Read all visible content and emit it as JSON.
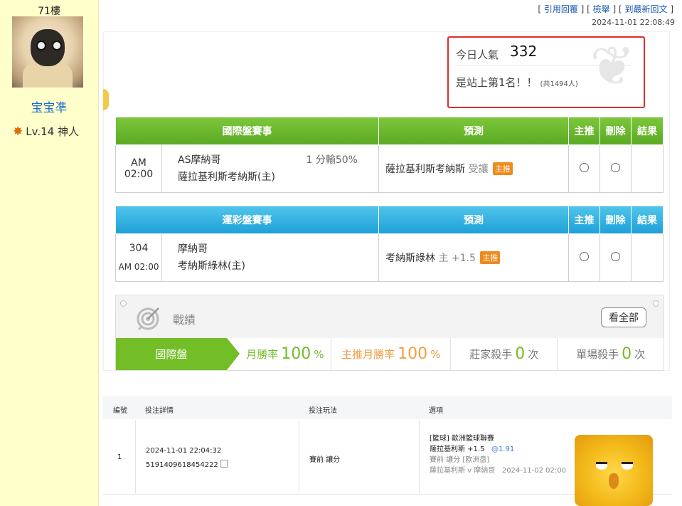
{
  "user": {
    "floor": "71樓",
    "name": "宝宝凖",
    "level": "Lv.14 神人"
  },
  "post": {
    "links": [
      "引用回覆",
      "檢舉",
      "到最新回文"
    ],
    "time": "2024-11-01 22:08:49"
  },
  "popularity": {
    "label": "今日人氣",
    "count": "332",
    "rank_text": "是站上第1名！！",
    "total": "(共1494人)"
  },
  "intl_table": {
    "headers": [
      "國際盤賽事",
      "預測",
      "主推",
      "刪除",
      "結果"
    ],
    "row": {
      "time": "AM 02:00",
      "team1": "AS摩納哥",
      "team2": "薩拉基利斯考納斯(主)",
      "odds": "1 分輸50%",
      "pick": "薩拉基利斯考納斯",
      "pick_type": "受讓",
      "tag": "主推"
    }
  },
  "lottery_table": {
    "headers": [
      "運彩盤賽事",
      "預測",
      "主推",
      "刪除",
      "結果"
    ],
    "row": {
      "number": "304",
      "time": "AM 02:00",
      "team1": "摩納哥",
      "team2": "考納斯綠林(主)",
      "pick": "考納斯綠林",
      "pick_type": "主 +1.5",
      "tag": "主推"
    }
  },
  "record": {
    "title": "戰績",
    "view_all": "看全部",
    "category": "國際盤",
    "stats": [
      {
        "label": "月勝率",
        "value": "100",
        "unit": "%",
        "color": "#73bd27"
      },
      {
        "label": "主推月勝率",
        "value": "100",
        "unit": "%",
        "color": "#f39c43"
      },
      {
        "label": "莊家殺手",
        "value": "0",
        "unit": "次",
        "color": "#73bd27"
      },
      {
        "label": "單場殺手",
        "value": "0",
        "unit": "次",
        "color": "#73bd27"
      }
    ]
  },
  "bet": {
    "headers": [
      "編號",
      "投注詳情",
      "投注玩法",
      "選項"
    ],
    "row": {
      "index": "1",
      "datetime": "2024-11-01 22:04:32",
      "serial": "5191409618454222",
      "play": "賽前 讓分",
      "league": "[籃球] 歐洲籃球聯賽",
      "selection": "薩拉基利斯 +1.5",
      "odds": "@1.91",
      "market": "賽前 讓分 [欧洲盘]",
      "match": "薩拉基利斯 v 摩納哥",
      "match_time": "2024-11-02 02:00"
    }
  }
}
